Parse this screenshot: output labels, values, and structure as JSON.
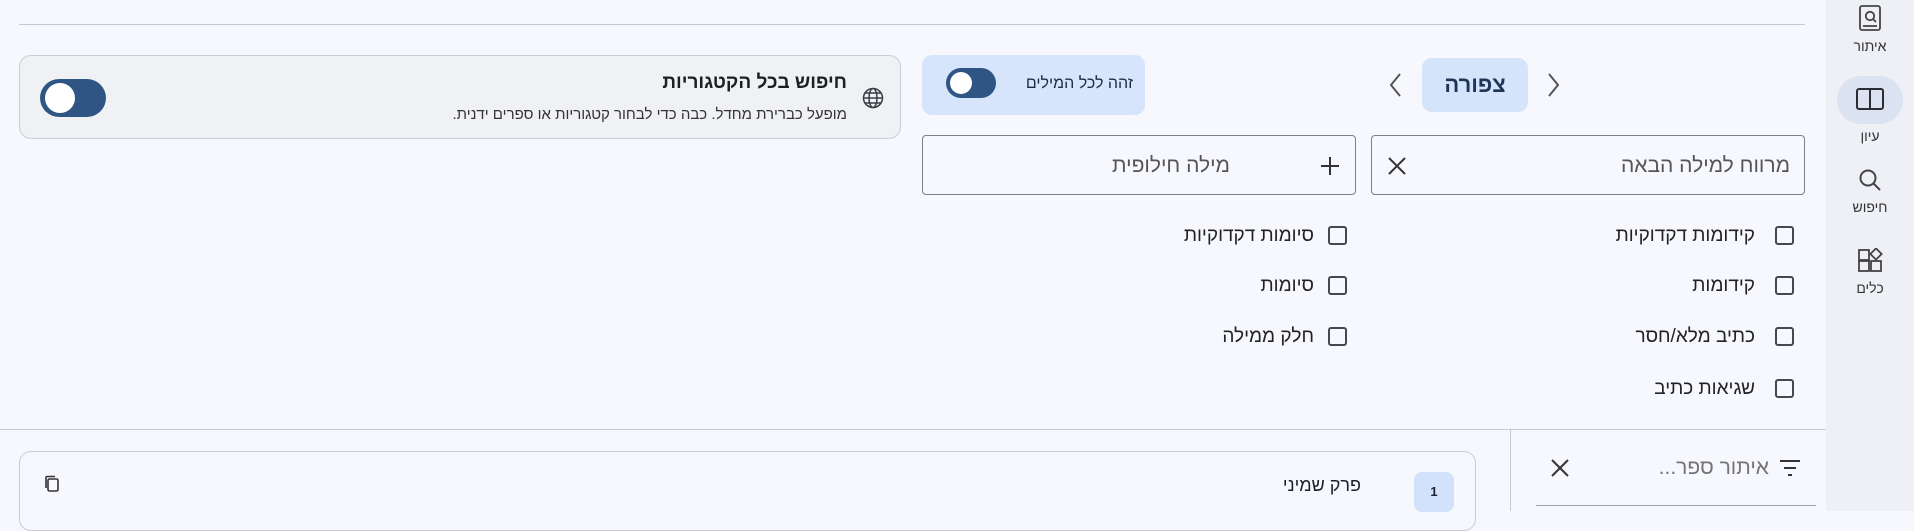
{
  "nav": {
    "items": [
      {
        "label": "איתור",
        "icon": "book-search-icon"
      },
      {
        "label": "עיון",
        "icon": "open-book-icon"
      },
      {
        "label": "חיפוש",
        "icon": "search-icon"
      },
      {
        "label": "כלים",
        "icon": "tools-icon"
      }
    ],
    "active": "עיון"
  },
  "categories": {
    "title": "חיפוש בכל הקטגוריות",
    "subtitle": "מופעל כברירת מחדל. כבה כדי לבחור קטגוריות או ספרים ידנית.",
    "icon": "globe-icon",
    "enabled": true
  },
  "match_all": {
    "label": "זהה לכל המילים",
    "enabled": true
  },
  "word_nav": {
    "current_word": "צפורה",
    "prev_icon": "chevron-left-icon",
    "next_icon": "chevron-right-icon"
  },
  "gap_field": {
    "placeholder": "מרווח למילה הבאה",
    "value": ""
  },
  "alt_field": {
    "placeholder": "מילה חילופית",
    "value": ""
  },
  "options_right": [
    {
      "label": "קידומות דקדוקיות",
      "checked": false
    },
    {
      "label": "קידומות",
      "checked": false
    },
    {
      "label": "כתיב מלא/חסר",
      "checked": false
    },
    {
      "label": "שגיאות כתיב",
      "checked": false
    }
  ],
  "options_left": [
    {
      "label": "סיומות דקדוקיות",
      "checked": false
    },
    {
      "label": "סיומות",
      "checked": false
    },
    {
      "label": "חלק ממילה",
      "checked": false
    }
  ],
  "book_filter": {
    "placeholder": "איתור ספר...",
    "value": ""
  },
  "results": [
    {
      "number": "1",
      "title": "פרק שמיני"
    }
  ]
}
